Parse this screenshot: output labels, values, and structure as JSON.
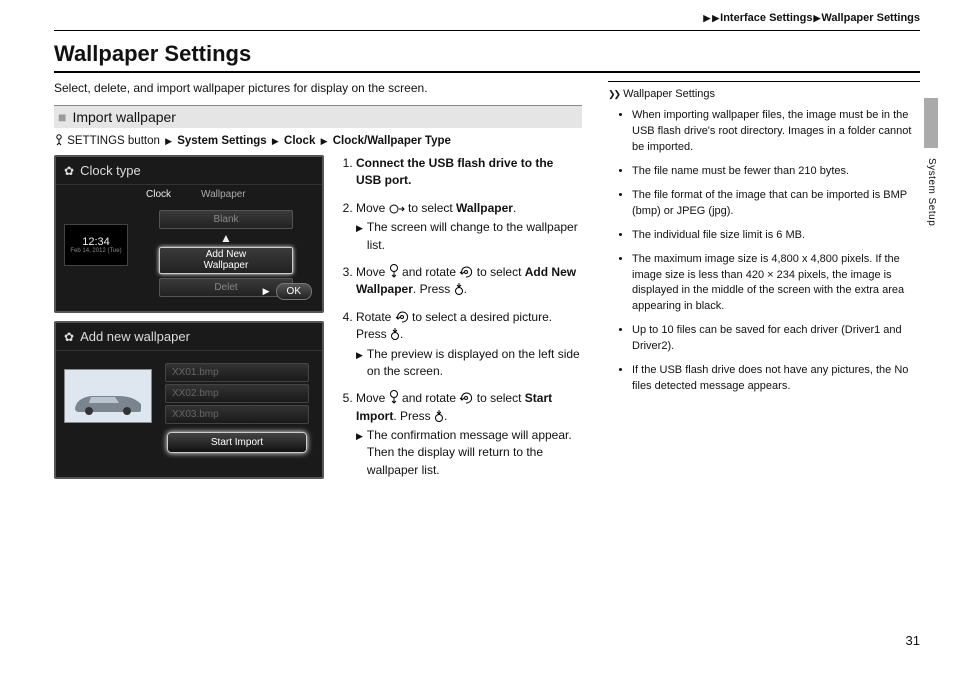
{
  "breadcrumb": {
    "a": "Interface Settings",
    "b": "Wallpaper Settings"
  },
  "title": "Wallpaper Settings",
  "intro": "Select, delete, and import wallpaper pictures for display on the screen.",
  "subhead": "Import wallpaper",
  "path": {
    "prefix": "SETTINGS button",
    "p1": "System Settings",
    "p2": "Clock",
    "p3": "Clock/Wallpaper Type"
  },
  "shot1": {
    "title": "Clock type",
    "tab1": "Clock",
    "tab2": "Wallpaper",
    "time": "12:34",
    "date": "Feb 14, 2012 (Tue)",
    "opt_blank": "Blank",
    "opt_sel_l1": "Add New",
    "opt_sel_l2": "Wallpaper",
    "opt_del": "Delet",
    "ok": "OK"
  },
  "shot2": {
    "title": "Add new wallpaper",
    "f1": "XX01.bmp",
    "f2": "XX02.bmp",
    "f3": "XX03.bmp",
    "btn": "Start Import"
  },
  "steps": {
    "s1": "Connect the USB flash drive to the USB port.",
    "s2a": "Move ",
    "s2b": " to select ",
    "s2c": "Wallpaper",
    "s2d": ".",
    "s2r": "The screen will change to the wallpaper list.",
    "s3a": "Move ",
    "s3b": " and rotate ",
    "s3c": " to select ",
    "s3d": "Add New Wallpaper",
    "s3e": ". Press ",
    "s3f": ".",
    "s4a": "Rotate ",
    "s4b": " to select a desired picture. Press ",
    "s4c": ".",
    "s4r": "The preview is displayed on the left side on the screen.",
    "s5a": "Move ",
    "s5b": " and rotate ",
    "s5c": " to select ",
    "s5d": "Start Import",
    "s5e": ". Press ",
    "s5f": ".",
    "s5r": "The confirmation message will appear. Then the display will return to the wallpaper list."
  },
  "side": {
    "title": "Wallpaper Settings",
    "n1": "When importing wallpaper files, the image must be in the USB flash drive's root directory. Images in a folder cannot be imported.",
    "n2": "The file name must be fewer than 210 bytes.",
    "n3": "The file format of the image that can be imported is BMP (bmp) or JPEG (jpg).",
    "n4": "The individual file size limit is 6 MB.",
    "n5": "The maximum image size is 4,800 x 4,800 pixels. If the image size is less than 420 × 234 pixels, the image is displayed in the middle of the screen with the extra area appearing in black.",
    "n6": "Up to 10 files can be saved for each driver (Driver1 and Driver2).",
    "n7": "If the USB flash drive does not have any pictures, the No files detected message appears."
  },
  "sideLabel": "System Setup",
  "pageNum": "31"
}
